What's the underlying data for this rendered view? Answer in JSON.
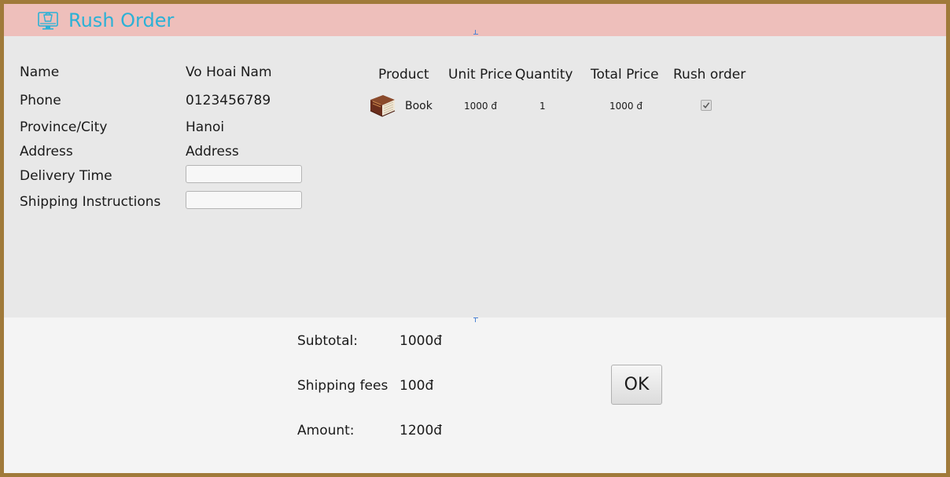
{
  "window": {
    "title": "Rush Order",
    "icon": "shopping-monitor-icon"
  },
  "customer": {
    "fields": [
      {
        "label": "Name",
        "value": "Vo Hoai Nam"
      },
      {
        "label": "Phone",
        "value": "0123456789"
      },
      {
        "label": "Province/City",
        "value": "Hanoi"
      },
      {
        "label": "Address",
        "value": "Address"
      }
    ],
    "inputs": [
      {
        "label": "Delivery Time",
        "value": "",
        "placeholder": ""
      },
      {
        "label": "Shipping Instructions",
        "value": "",
        "placeholder": ""
      }
    ]
  },
  "products": {
    "headers": [
      "Product",
      "Unit Price",
      "Quantity",
      "Total Price",
      "Rush order"
    ],
    "rows": [
      {
        "name": "Book",
        "image": "book-icon",
        "unit_price": "1000 đ",
        "quantity": "1",
        "total_price": "1000 đ",
        "rush_order": true
      }
    ]
  },
  "summary": {
    "subtotal_label": "Subtotal:",
    "subtotal_value": "1000đ",
    "shipping_label": "Shipping fees",
    "shipping_value": "100đ",
    "amount_label": "Amount:",
    "amount_value": "1200đ"
  },
  "actions": {
    "ok_label": "OK"
  },
  "colors": {
    "title_bar": "#eebfbb",
    "title_text": "#2bb1d6",
    "frame_border": "#a07a3a",
    "upper_panel": "#e8e8e8",
    "lower_panel": "#f4f4f4"
  }
}
